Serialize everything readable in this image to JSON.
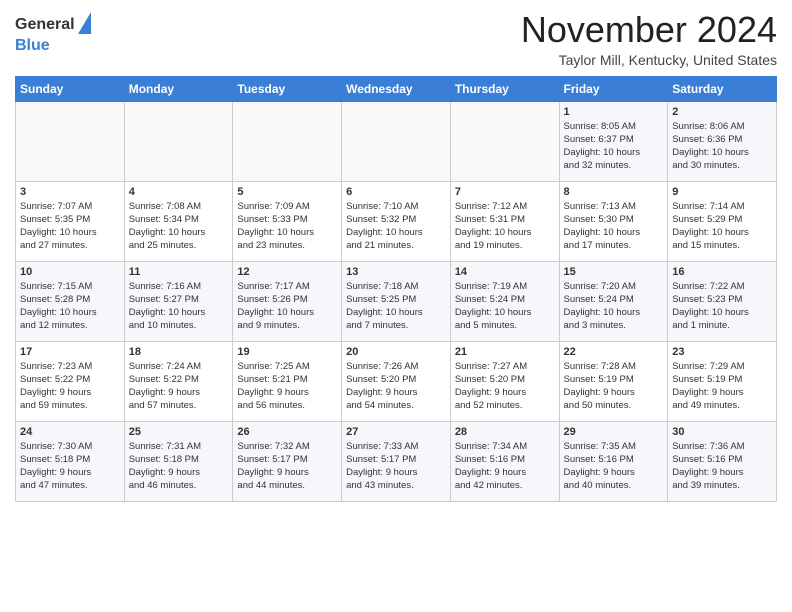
{
  "logo": {
    "line1": "General",
    "line2": "Blue"
  },
  "title": "November 2024",
  "location": "Taylor Mill, Kentucky, United States",
  "days_header": [
    "Sunday",
    "Monday",
    "Tuesday",
    "Wednesday",
    "Thursday",
    "Friday",
    "Saturday"
  ],
  "weeks": [
    [
      {
        "day": "",
        "info": ""
      },
      {
        "day": "",
        "info": ""
      },
      {
        "day": "",
        "info": ""
      },
      {
        "day": "",
        "info": ""
      },
      {
        "day": "",
        "info": ""
      },
      {
        "day": "1",
        "info": "Sunrise: 8:05 AM\nSunset: 6:37 PM\nDaylight: 10 hours\nand 32 minutes."
      },
      {
        "day": "2",
        "info": "Sunrise: 8:06 AM\nSunset: 6:36 PM\nDaylight: 10 hours\nand 30 minutes."
      }
    ],
    [
      {
        "day": "3",
        "info": "Sunrise: 7:07 AM\nSunset: 5:35 PM\nDaylight: 10 hours\nand 27 minutes."
      },
      {
        "day": "4",
        "info": "Sunrise: 7:08 AM\nSunset: 5:34 PM\nDaylight: 10 hours\nand 25 minutes."
      },
      {
        "day": "5",
        "info": "Sunrise: 7:09 AM\nSunset: 5:33 PM\nDaylight: 10 hours\nand 23 minutes."
      },
      {
        "day": "6",
        "info": "Sunrise: 7:10 AM\nSunset: 5:32 PM\nDaylight: 10 hours\nand 21 minutes."
      },
      {
        "day": "7",
        "info": "Sunrise: 7:12 AM\nSunset: 5:31 PM\nDaylight: 10 hours\nand 19 minutes."
      },
      {
        "day": "8",
        "info": "Sunrise: 7:13 AM\nSunset: 5:30 PM\nDaylight: 10 hours\nand 17 minutes."
      },
      {
        "day": "9",
        "info": "Sunrise: 7:14 AM\nSunset: 5:29 PM\nDaylight: 10 hours\nand 15 minutes."
      }
    ],
    [
      {
        "day": "10",
        "info": "Sunrise: 7:15 AM\nSunset: 5:28 PM\nDaylight: 10 hours\nand 12 minutes."
      },
      {
        "day": "11",
        "info": "Sunrise: 7:16 AM\nSunset: 5:27 PM\nDaylight: 10 hours\nand 10 minutes."
      },
      {
        "day": "12",
        "info": "Sunrise: 7:17 AM\nSunset: 5:26 PM\nDaylight: 10 hours\nand 9 minutes."
      },
      {
        "day": "13",
        "info": "Sunrise: 7:18 AM\nSunset: 5:25 PM\nDaylight: 10 hours\nand 7 minutes."
      },
      {
        "day": "14",
        "info": "Sunrise: 7:19 AM\nSunset: 5:24 PM\nDaylight: 10 hours\nand 5 minutes."
      },
      {
        "day": "15",
        "info": "Sunrise: 7:20 AM\nSunset: 5:24 PM\nDaylight: 10 hours\nand 3 minutes."
      },
      {
        "day": "16",
        "info": "Sunrise: 7:22 AM\nSunset: 5:23 PM\nDaylight: 10 hours\nand 1 minute."
      }
    ],
    [
      {
        "day": "17",
        "info": "Sunrise: 7:23 AM\nSunset: 5:22 PM\nDaylight: 9 hours\nand 59 minutes."
      },
      {
        "day": "18",
        "info": "Sunrise: 7:24 AM\nSunset: 5:22 PM\nDaylight: 9 hours\nand 57 minutes."
      },
      {
        "day": "19",
        "info": "Sunrise: 7:25 AM\nSunset: 5:21 PM\nDaylight: 9 hours\nand 56 minutes."
      },
      {
        "day": "20",
        "info": "Sunrise: 7:26 AM\nSunset: 5:20 PM\nDaylight: 9 hours\nand 54 minutes."
      },
      {
        "day": "21",
        "info": "Sunrise: 7:27 AM\nSunset: 5:20 PM\nDaylight: 9 hours\nand 52 minutes."
      },
      {
        "day": "22",
        "info": "Sunrise: 7:28 AM\nSunset: 5:19 PM\nDaylight: 9 hours\nand 50 minutes."
      },
      {
        "day": "23",
        "info": "Sunrise: 7:29 AM\nSunset: 5:19 PM\nDaylight: 9 hours\nand 49 minutes."
      }
    ],
    [
      {
        "day": "24",
        "info": "Sunrise: 7:30 AM\nSunset: 5:18 PM\nDaylight: 9 hours\nand 47 minutes."
      },
      {
        "day": "25",
        "info": "Sunrise: 7:31 AM\nSunset: 5:18 PM\nDaylight: 9 hours\nand 46 minutes."
      },
      {
        "day": "26",
        "info": "Sunrise: 7:32 AM\nSunset: 5:17 PM\nDaylight: 9 hours\nand 44 minutes."
      },
      {
        "day": "27",
        "info": "Sunrise: 7:33 AM\nSunset: 5:17 PM\nDaylight: 9 hours\nand 43 minutes."
      },
      {
        "day": "28",
        "info": "Sunrise: 7:34 AM\nSunset: 5:16 PM\nDaylight: 9 hours\nand 42 minutes."
      },
      {
        "day": "29",
        "info": "Sunrise: 7:35 AM\nSunset: 5:16 PM\nDaylight: 9 hours\nand 40 minutes."
      },
      {
        "day": "30",
        "info": "Sunrise: 7:36 AM\nSunset: 5:16 PM\nDaylight: 9 hours\nand 39 minutes."
      }
    ]
  ]
}
